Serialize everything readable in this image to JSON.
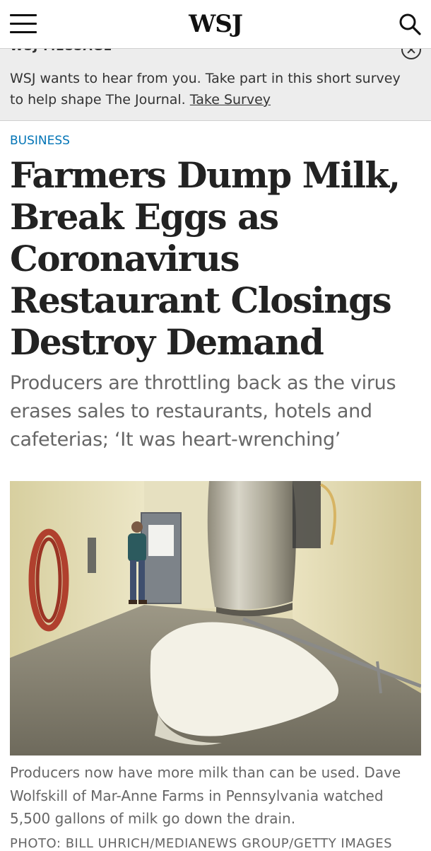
{
  "header": {
    "logo": "WSJ",
    "menu_icon": "hamburger-menu-icon",
    "search_icon": "search-icon"
  },
  "banner": {
    "label": "WSJ MESSAGE",
    "text": "WSJ wants to hear from you. Take part in this short survey to help shape The Journal.",
    "link": "Take Survey",
    "close_icon": "close-circle-icon"
  },
  "article": {
    "section": "BUSINESS",
    "headline": "Farmers Dump Milk, Break Eggs as Coronavirus Restaurant Closings Destroy Demand",
    "dek": "Producers are throttling back as the virus erases sales to restaurants, hotels and cafeterias; ‘It was heart-wrenching’",
    "image_caption": "Producers now have more milk than can be used. Dave Wolfskill of Mar-Anne Farms in Pennsylvania watched 5,500 gallons of milk go down the drain.",
    "photo_credit": "PHOTO: BILL UHRICH/MEDIANEWS GROUP/GETTY IMAGES"
  },
  "colors": {
    "section_link": "#0274b6",
    "banner_bg": "#ededed",
    "headline": "#222222",
    "dek": "#666666"
  }
}
